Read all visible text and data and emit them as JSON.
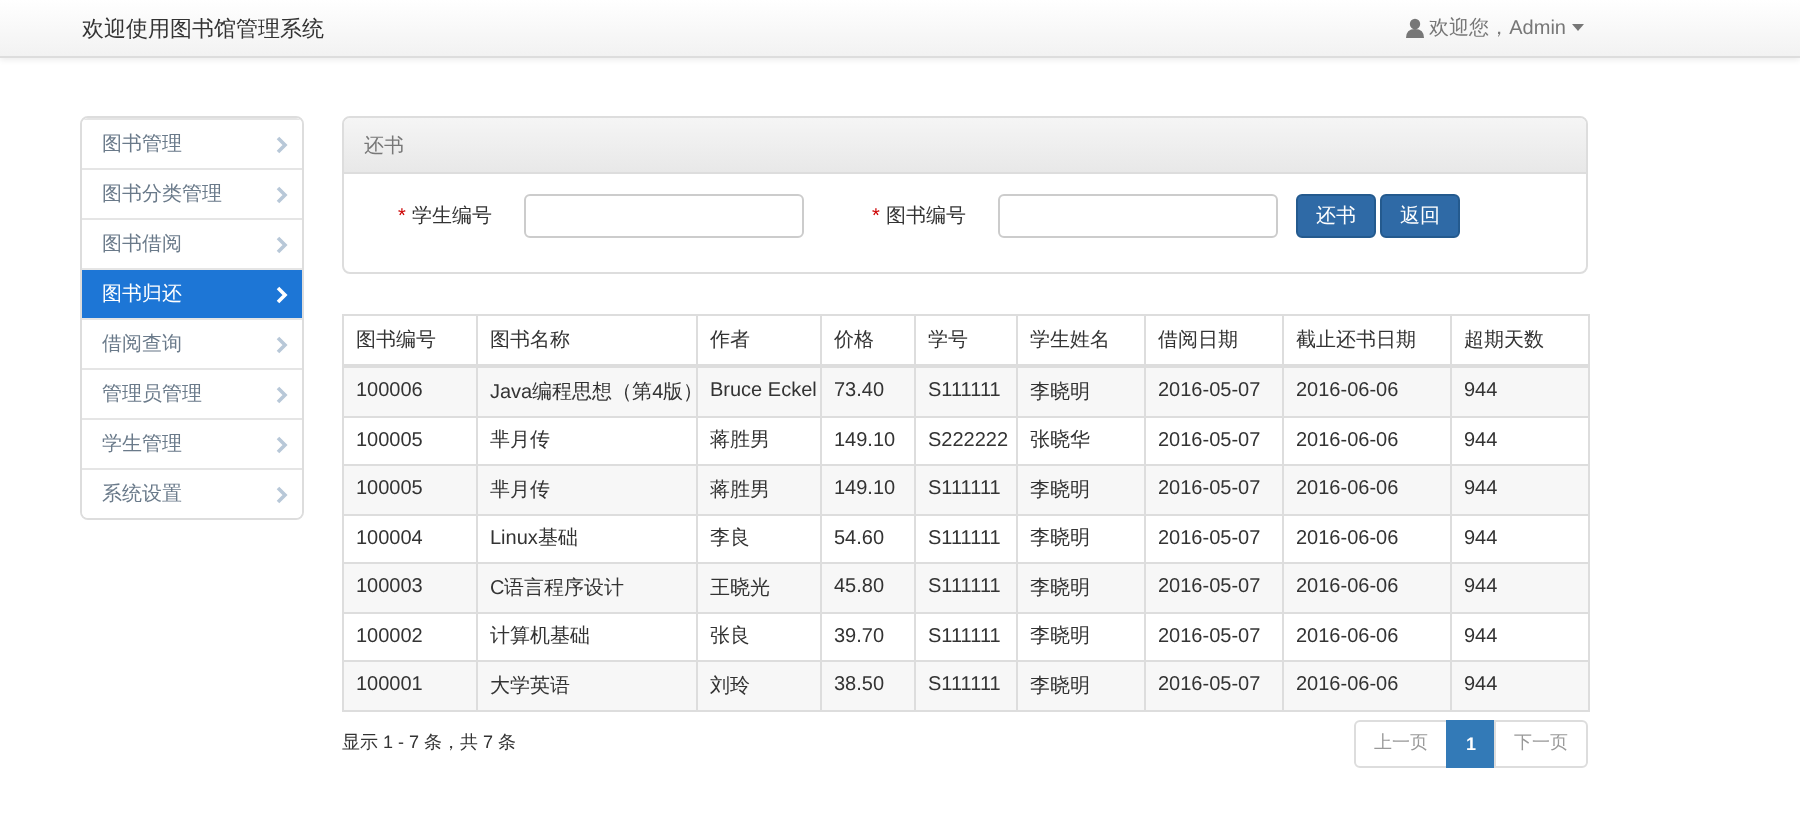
{
  "navbar": {
    "title": "欢迎使用图书馆管理系统",
    "user": "欢迎您，Admin"
  },
  "sidebar": {
    "items": [
      {
        "label": "图书管理",
        "selected": false
      },
      {
        "label": "图书分类管理",
        "selected": false
      },
      {
        "label": "图书借阅",
        "selected": false
      },
      {
        "label": "图书归还",
        "selected": true
      },
      {
        "label": "借阅查询",
        "selected": false
      },
      {
        "label": "管理员管理",
        "selected": false
      },
      {
        "label": "学生管理",
        "selected": false
      },
      {
        "label": "系统设置",
        "selected": false
      }
    ]
  },
  "panel": {
    "title": "还书",
    "fields": [
      {
        "marker": "*",
        "label": "学生编号"
      },
      {
        "marker": "*",
        "label": "图书编号"
      }
    ],
    "buttons": [
      "还书",
      "返回"
    ]
  },
  "table": {
    "columns": [
      "图书编号",
      "图书名称",
      "作者",
      "价格",
      "学号",
      "学生姓名",
      "借阅日期",
      "截止还书日期",
      "超期天数"
    ],
    "rows": [
      [
        "100006",
        "Java编程思想（第4版）",
        "Bruce Eckel",
        "73.40",
        "S111111",
        "李晓明",
        "2016-05-07",
        "2016-06-06",
        "944"
      ],
      [
        "100005",
        "芈月传",
        "蒋胜男",
        "149.10",
        "S222222",
        "张晓华",
        "2016-05-07",
        "2016-06-06",
        "944"
      ],
      [
        "100005",
        "芈月传",
        "蒋胜男",
        "149.10",
        "S111111",
        "李晓明",
        "2016-05-07",
        "2016-06-06",
        "944"
      ],
      [
        "100004",
        "Linux基础",
        "李良",
        "54.60",
        "S111111",
        "李晓明",
        "2016-05-07",
        "2016-06-06",
        "944"
      ],
      [
        "100003",
        "C语言程序设计",
        "王晓光",
        "45.80",
        "S111111",
        "李晓明",
        "2016-05-07",
        "2016-06-06",
        "944"
      ],
      [
        "100002",
        "计算机基础",
        "张良",
        "39.70",
        "S111111",
        "李晓明",
        "2016-05-07",
        "2016-06-06",
        "944"
      ],
      [
        "100001",
        "大学英语",
        "刘玲",
        "38.50",
        "S111111",
        "李晓明",
        "2016-05-07",
        "2016-06-06",
        "944"
      ]
    ]
  },
  "footer": {
    "summary": "显示 1 - 7 条，共 7 条",
    "pages": [
      {
        "label": "上一页",
        "selected": false
      },
      {
        "label": "1",
        "selected": true
      },
      {
        "label": "下一页",
        "selected": false
      }
    ]
  }
}
